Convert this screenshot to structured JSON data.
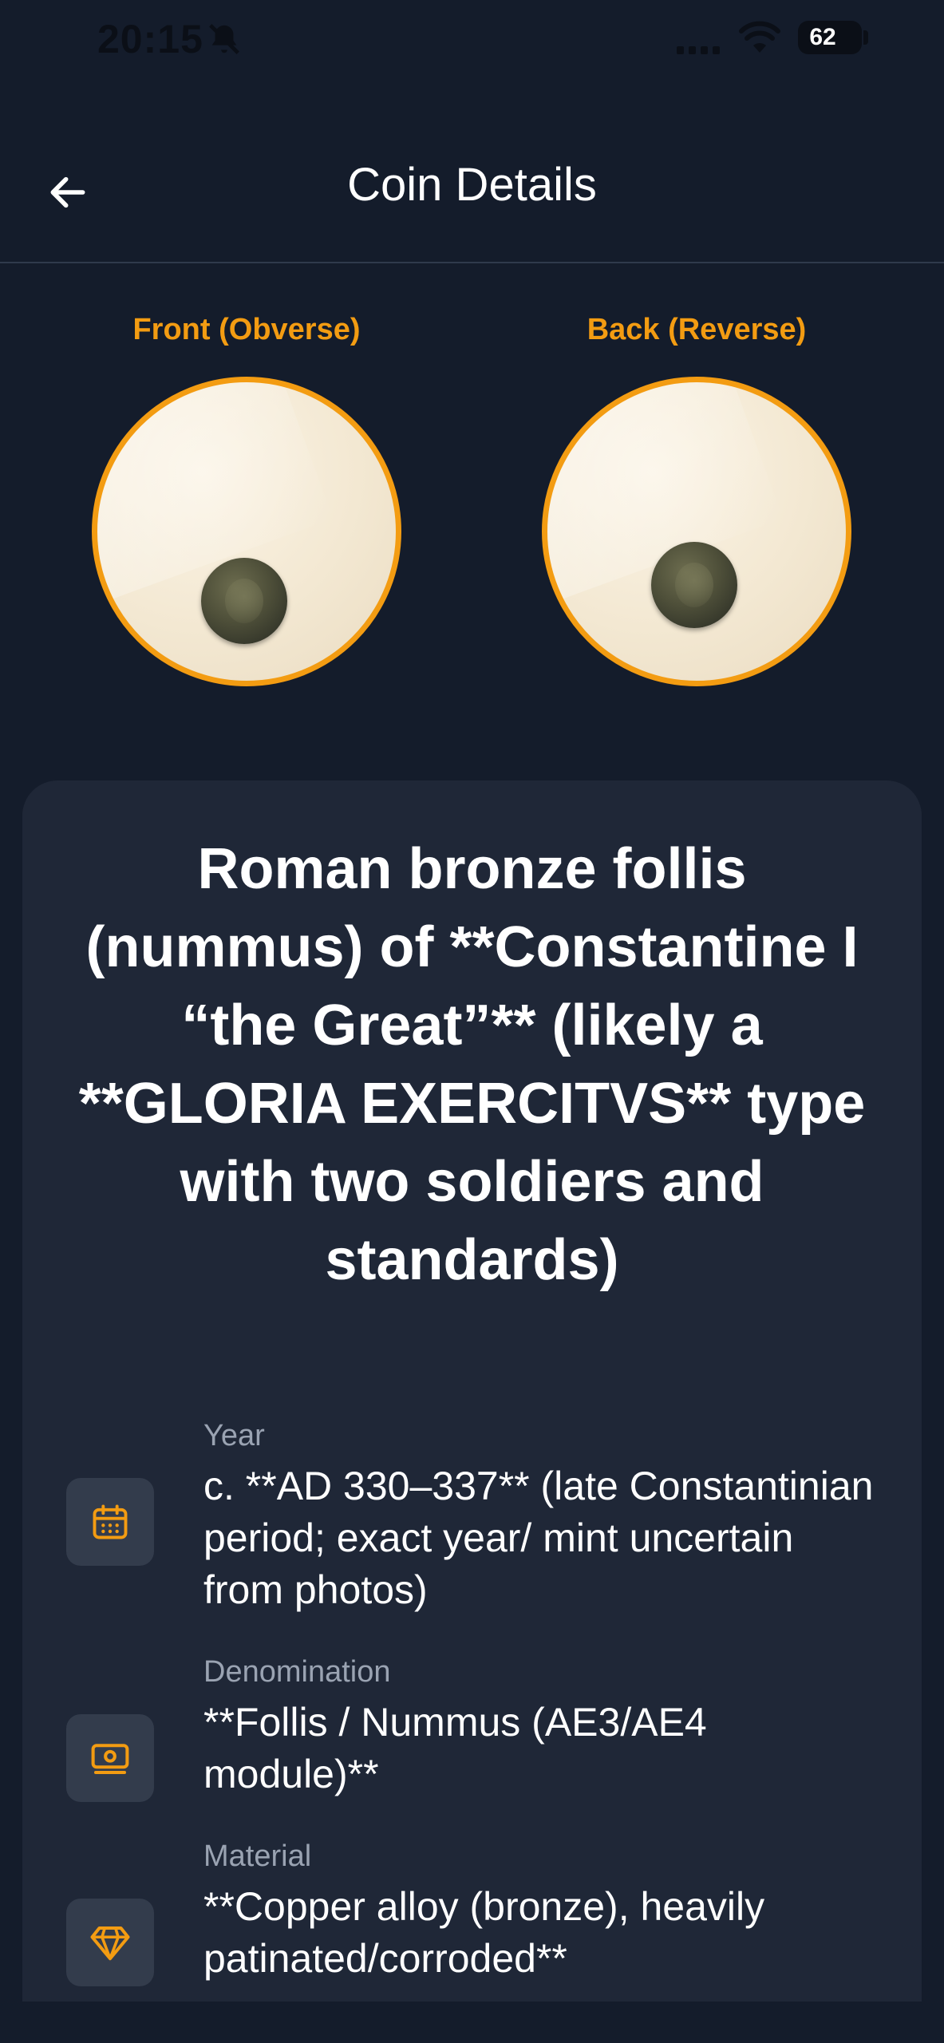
{
  "status_bar": {
    "time": "20:15",
    "battery": "62",
    "battery_level": 0.62,
    "icons": [
      "bell-slash-icon",
      "signal-icon",
      "wifi-icon",
      "battery-icon"
    ]
  },
  "header": {
    "title": "Coin Details",
    "back_icon": "arrow-left-icon"
  },
  "images": {
    "front_label": "Front (Obverse)",
    "back_label": "Back (Reverse)"
  },
  "coin": {
    "title": "Roman bronze follis (nummus) of **Constantine I “the Great”** (likely a **GLORIA EXERCITVS** type with two soldiers and standards)",
    "details": [
      {
        "label": "Year",
        "value": "c. **AD 330–337** (late Constantinian period; exact year/ mint uncertain from photos)",
        "icon": "calendar-icon"
      },
      {
        "label": "Denomination",
        "value": "**Follis / Nummus (AE3/AE4 module)**",
        "icon": "banknote-icon"
      },
      {
        "label": "Material",
        "value": "**Copper alloy (bronze), heavily patinated/corroded**",
        "icon": "gem-icon"
      }
    ]
  },
  "colors": {
    "background": "#141c2b",
    "card": "#1f2737",
    "accent": "#f39c12",
    "muted_text": "#9aa3b2",
    "icon_tile": "#333c4c"
  }
}
